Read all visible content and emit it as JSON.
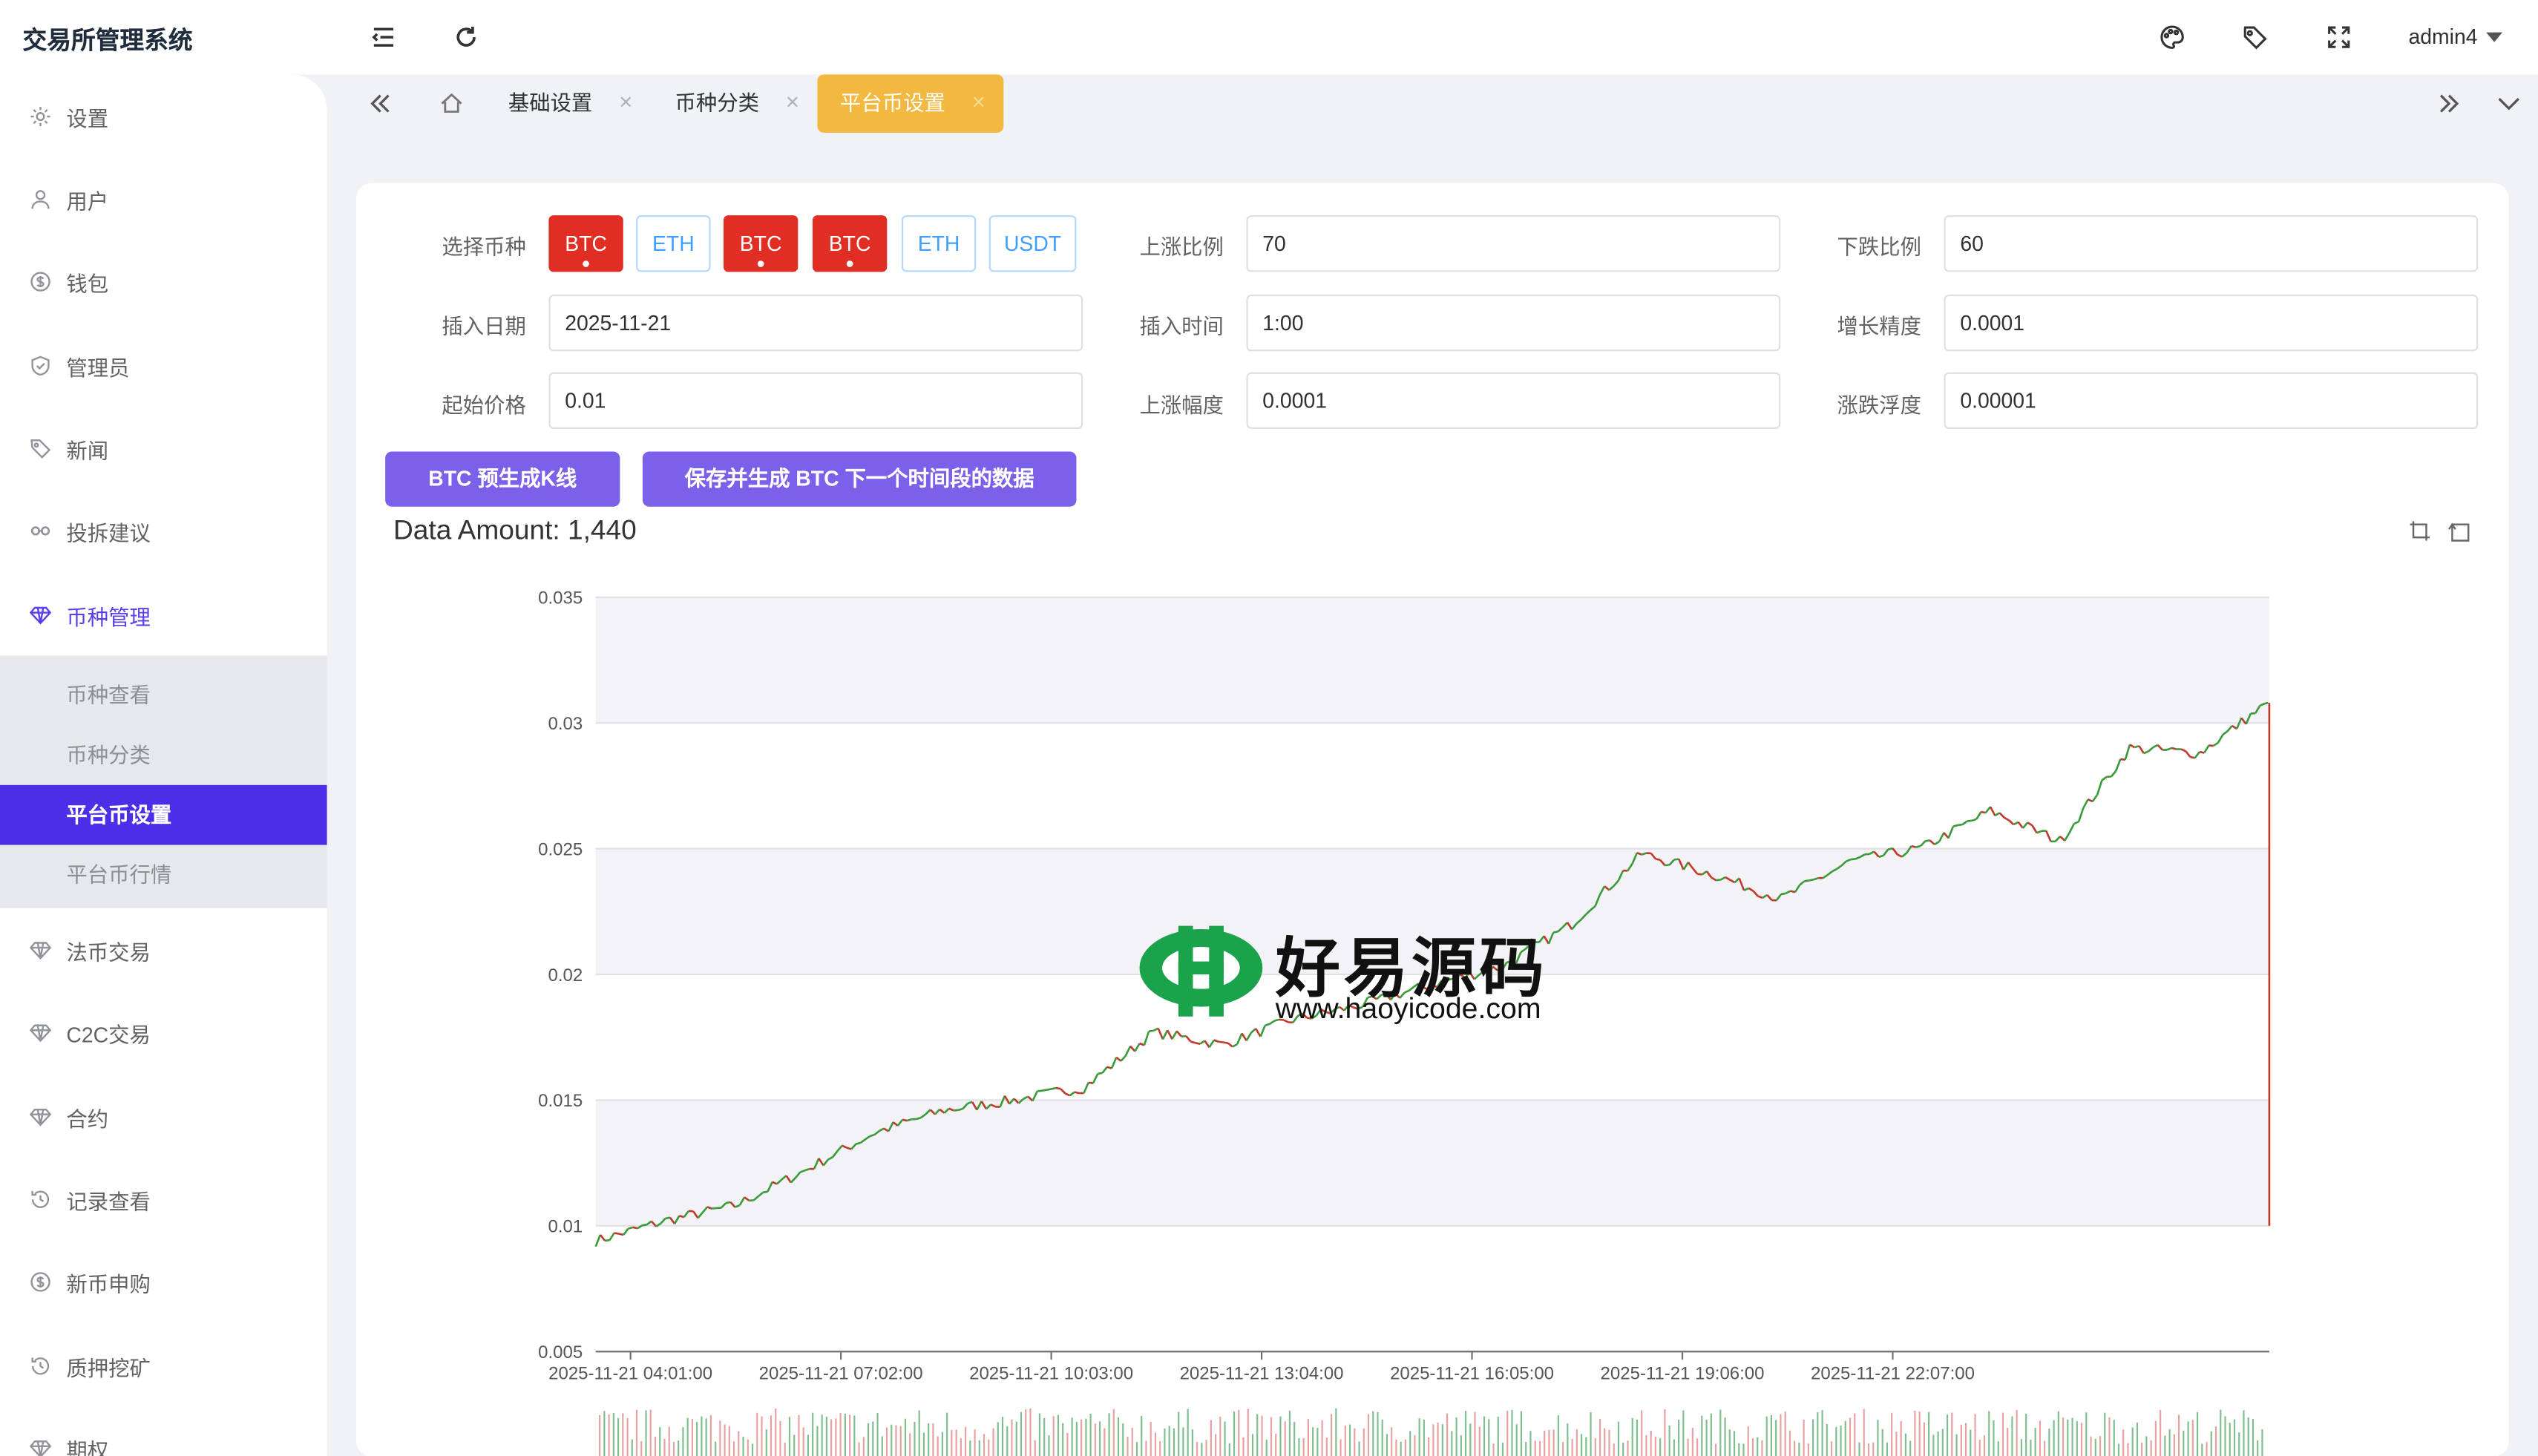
{
  "app": {
    "title": "交易所管理系统",
    "user": "admin4"
  },
  "sidebar": {
    "items": [
      {
        "label": "设置",
        "icon": "gear-icon"
      },
      {
        "label": "用户",
        "icon": "user-icon"
      },
      {
        "label": "钱包",
        "icon": "coin-icon"
      },
      {
        "label": "管理员",
        "icon": "shield-icon"
      },
      {
        "label": "新闻",
        "icon": "tag-icon"
      },
      {
        "label": "投拆建议",
        "icon": "link-icon"
      },
      {
        "label": "币种管理",
        "icon": "diamond-icon",
        "active": true
      },
      {
        "label": "法币交易",
        "icon": "diamond-icon"
      },
      {
        "label": "C2C交易",
        "icon": "diamond-icon"
      },
      {
        "label": "合约",
        "icon": "diamond-icon"
      },
      {
        "label": "记录查看",
        "icon": "history-icon"
      },
      {
        "label": "新币申购",
        "icon": "coin-icon"
      },
      {
        "label": "质押挖矿",
        "icon": "history-icon"
      },
      {
        "label": "期权",
        "icon": "diamond-icon"
      }
    ],
    "submenu": [
      {
        "label": "币种查看"
      },
      {
        "label": "币种分类"
      },
      {
        "label": "平台币设置",
        "active": true
      },
      {
        "label": "平台币行情"
      }
    ]
  },
  "tabs": [
    {
      "label": "基础设置"
    },
    {
      "label": "币种分类"
    },
    {
      "label": "平台币设置",
      "active": true
    }
  ],
  "form": {
    "coin_label": "选择币种",
    "coins": [
      {
        "label": "BTC",
        "selected": true
      },
      {
        "label": "ETH",
        "selected": false
      },
      {
        "label": "BTC",
        "selected": true
      },
      {
        "label": "BTC",
        "selected": true
      },
      {
        "label": "ETH",
        "selected": false
      },
      {
        "label": "USDT",
        "selected": false
      }
    ],
    "rise_ratio": {
      "label": "上涨比例",
      "value": "70"
    },
    "fall_ratio": {
      "label": "下跌比例",
      "value": "60"
    },
    "insert_date": {
      "label": "插入日期",
      "value": "2025-11-21"
    },
    "insert_time": {
      "label": "插入时间",
      "value": "1:00"
    },
    "growth_precision": {
      "label": "增长精度",
      "value": "0.0001"
    },
    "start_price": {
      "label": "起始价格",
      "value": "0.01"
    },
    "rise_range": {
      "label": "上涨幅度",
      "value": "0.0001"
    },
    "fluctuation": {
      "label": "涨跌浮度",
      "value": "0.00001"
    }
  },
  "actions": {
    "pregen_label": "BTC 预生成K线",
    "save_label": "保存并生成 BTC 下一个时间段的数据"
  },
  "chart_data": {
    "type": "line",
    "title": "Data Amount: 1,440",
    "ylim": [
      0.005,
      0.035
    ],
    "yticks": [
      "0.035",
      "0.03",
      "0.025",
      "0.02",
      "0.015",
      "0.01",
      "0.005"
    ],
    "xticks": [
      "2025-11-21 04:01:00",
      "2025-11-21 07:02:00",
      "2025-11-21 10:03:00",
      "2025-11-21 13:04:00",
      "2025-11-21 16:05:00",
      "2025-11-21 19:06:00",
      "2025-11-21 22:07:00"
    ],
    "series": [
      {
        "x": [
          0,
          60,
          120,
          180,
          240,
          300,
          360,
          420,
          480,
          540,
          600,
          660,
          720,
          780,
          840,
          900,
          960,
          1020,
          1080,
          1140,
          1200,
          1260,
          1320,
          1380,
          1439
        ],
        "values": [
          0.0094,
          0.0102,
          0.0108,
          0.0122,
          0.0137,
          0.0146,
          0.015,
          0.0155,
          0.0177,
          0.0172,
          0.0182,
          0.0188,
          0.0196,
          0.0203,
          0.022,
          0.0248,
          0.024,
          0.023,
          0.0245,
          0.025,
          0.0265,
          0.0253,
          0.029,
          0.0288,
          0.0308
        ]
      }
    ],
    "colors": {
      "up": "#3a9a3a",
      "down": "#c0392b",
      "volume": "#7fbf8f",
      "accent": "#c0392b"
    }
  },
  "watermark": {
    "text": "好易源码",
    "url": "www.haoyicode.com"
  }
}
